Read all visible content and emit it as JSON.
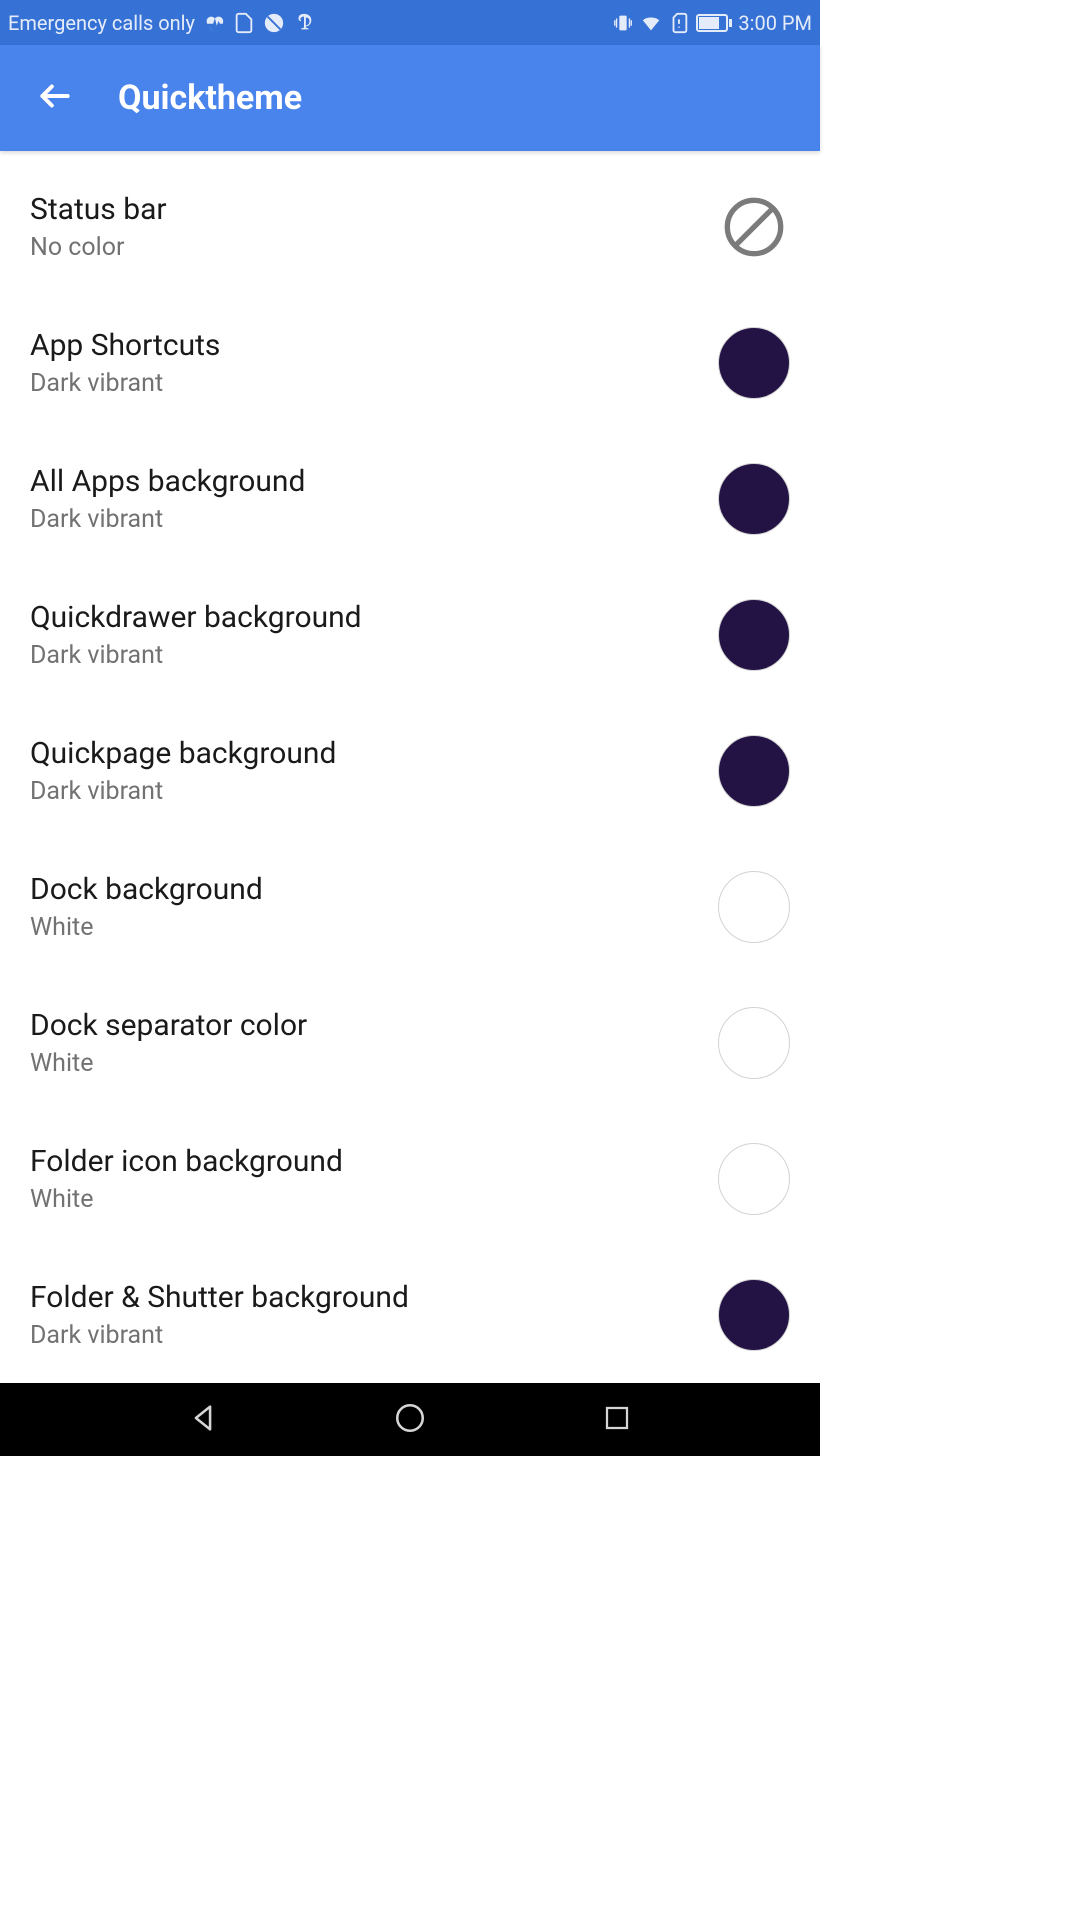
{
  "statusBar": {
    "carrier": "Emergency calls only",
    "time": "3:00 PM"
  },
  "appBar": {
    "title": "Quicktheme"
  },
  "colors": {
    "darkVibrant": "#231344",
    "white": "#ffffff"
  },
  "settings": [
    {
      "title": "Status bar",
      "subtitle": "No color",
      "swatchType": "no-color",
      "swatchColor": ""
    },
    {
      "title": "App Shortcuts",
      "subtitle": "Dark vibrant",
      "swatchType": "color",
      "swatchColor": "#231344"
    },
    {
      "title": "All Apps background",
      "subtitle": "Dark vibrant",
      "swatchType": "color",
      "swatchColor": "#231344"
    },
    {
      "title": "Quickdrawer background",
      "subtitle": "Dark vibrant",
      "swatchType": "color",
      "swatchColor": "#231344"
    },
    {
      "title": "Quickpage background",
      "subtitle": "Dark vibrant",
      "swatchType": "color",
      "swatchColor": "#231344"
    },
    {
      "title": "Dock background",
      "subtitle": "White",
      "swatchType": "color",
      "swatchColor": "#ffffff"
    },
    {
      "title": "Dock separator color",
      "subtitle": "White",
      "swatchType": "color",
      "swatchColor": "#ffffff"
    },
    {
      "title": "Folder icon background",
      "subtitle": "White",
      "swatchType": "color",
      "swatchColor": "#ffffff"
    },
    {
      "title": "Folder & Shutter background",
      "subtitle": "Dark vibrant",
      "swatchType": "color",
      "swatchColor": "#231344"
    }
  ]
}
